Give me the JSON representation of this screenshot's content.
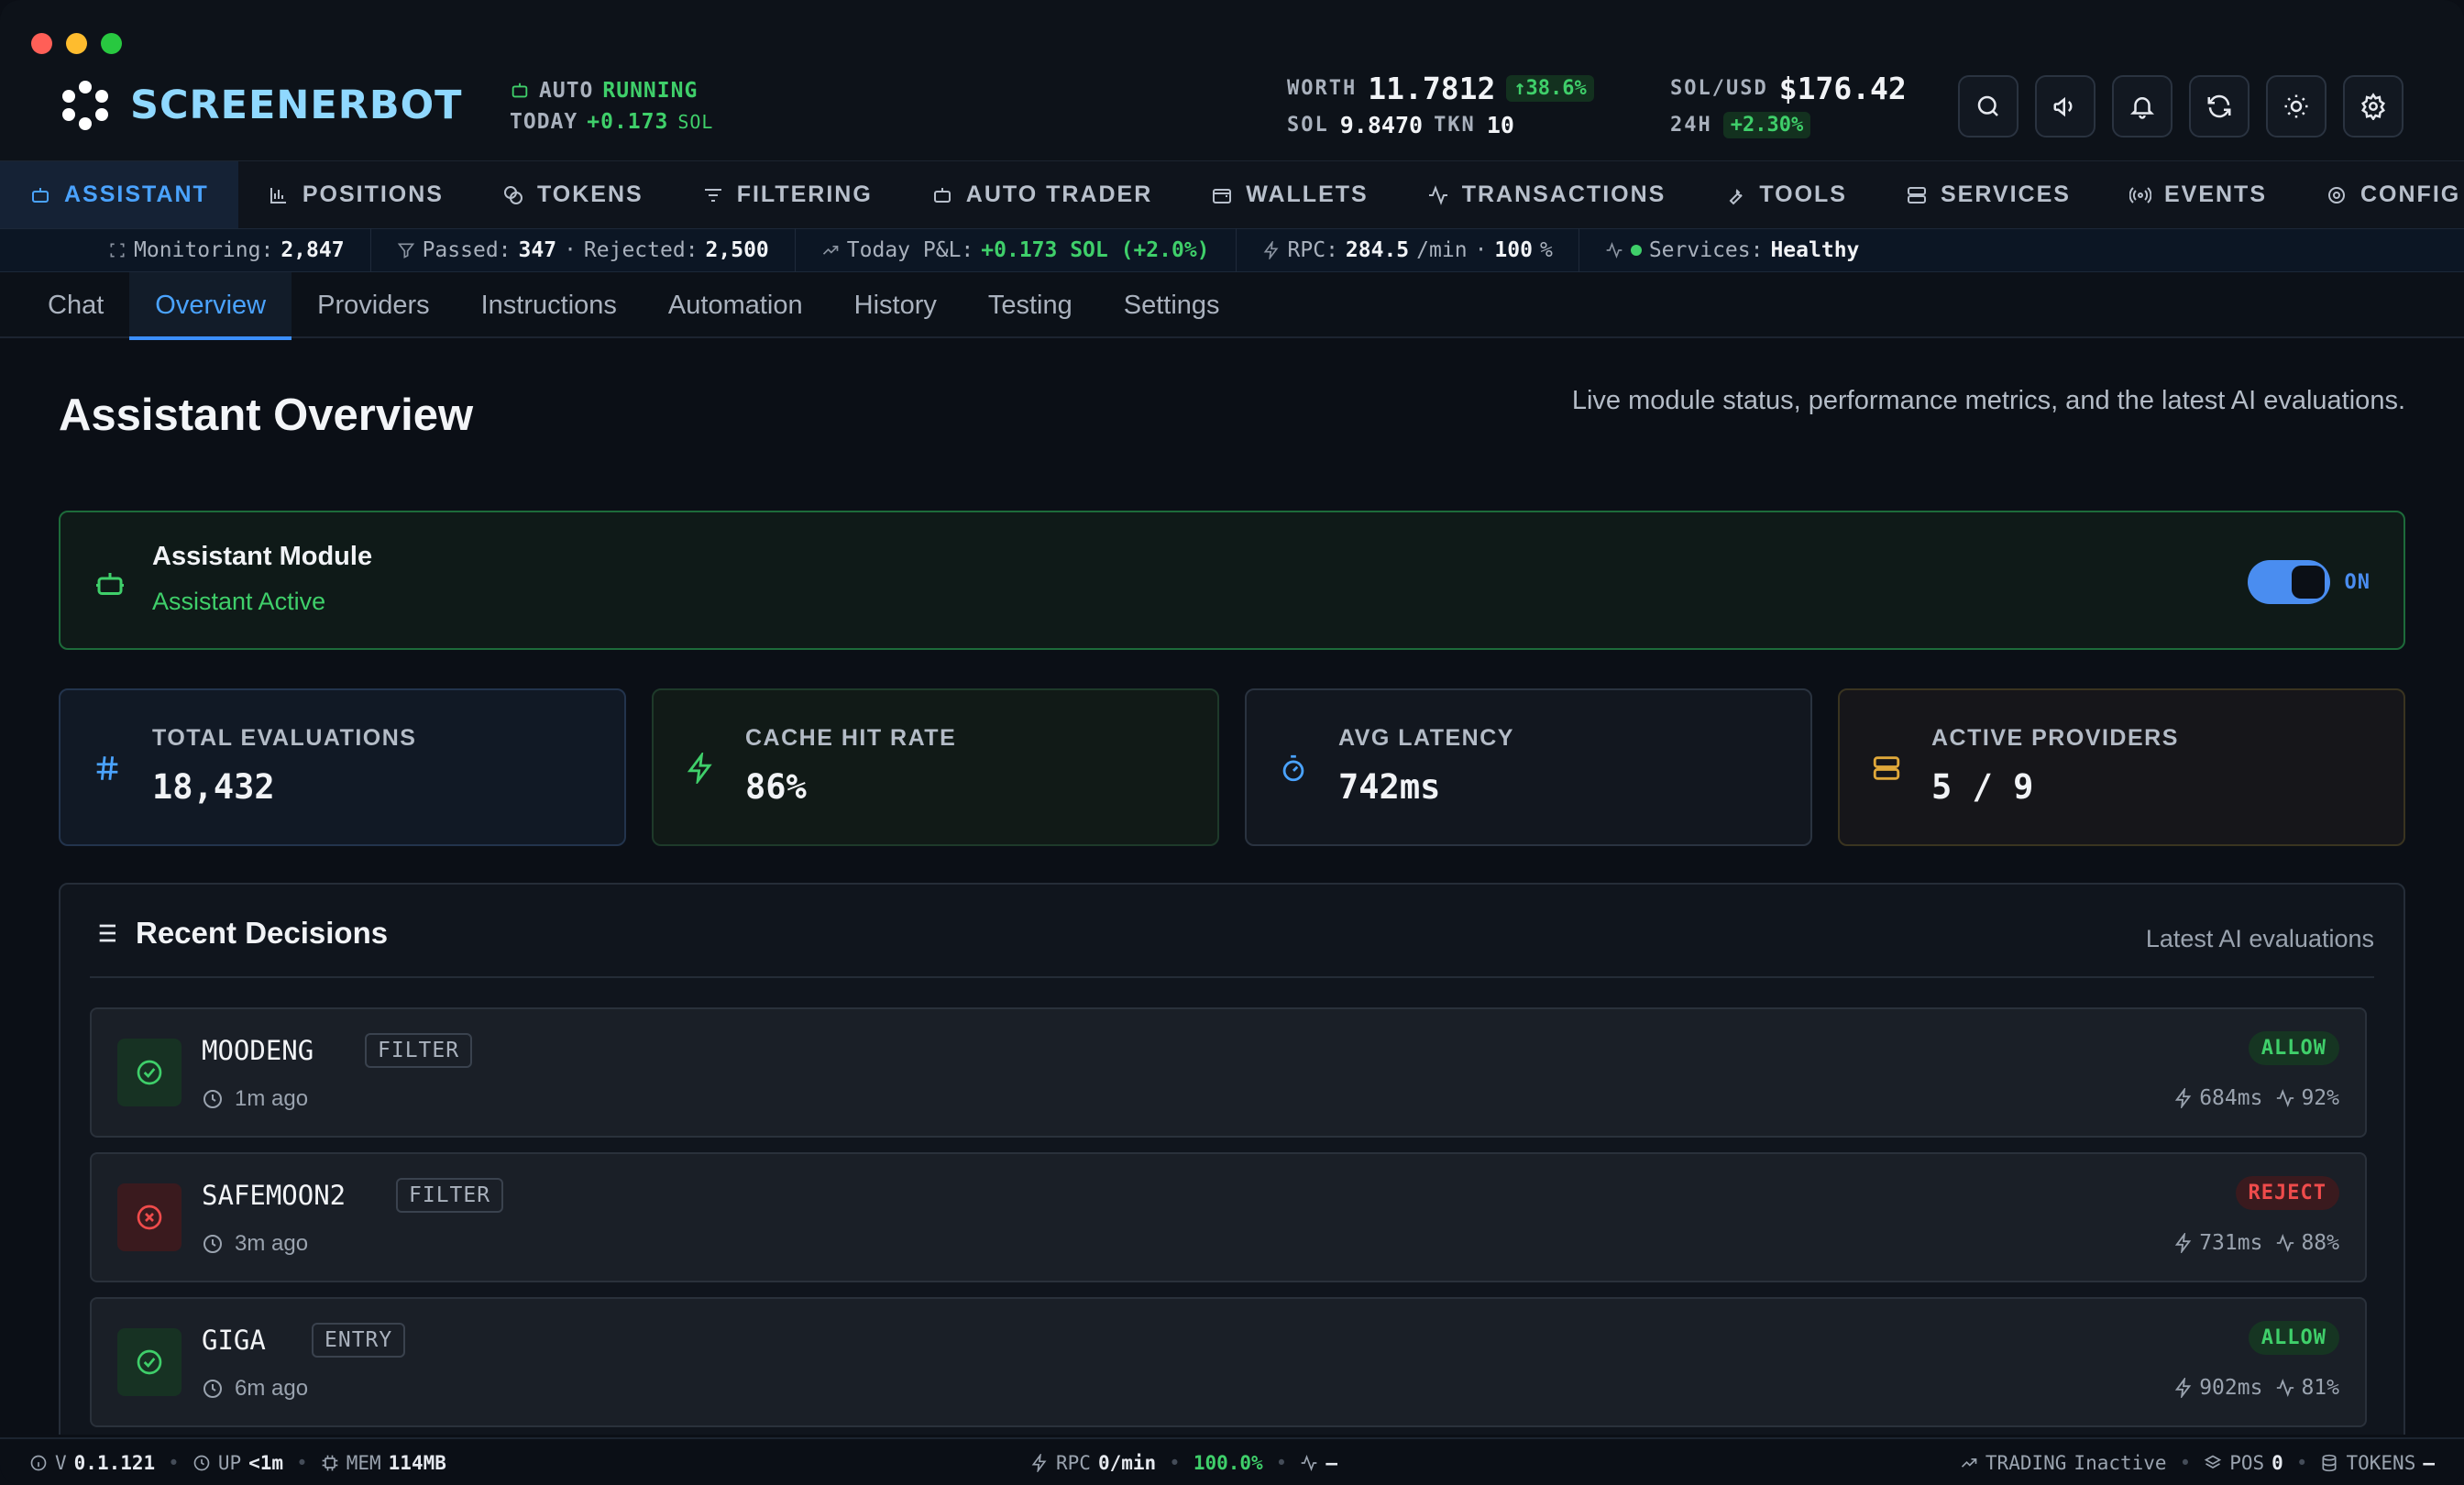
{
  "header": {
    "brand": "SCREENERBOT",
    "auto_label": "AUTO",
    "auto_status": "RUNNING",
    "today_label": "TODAY",
    "today_value": "+0.173",
    "today_unit": "SOL",
    "worth_label": "WORTH",
    "worth_value": "11.7812",
    "worth_change": "↑38.6%",
    "sol_label": "SOL",
    "sol_value": "9.8470",
    "tkn_label": "TKN",
    "tkn_value": "10",
    "solusd_label": "SOL/USD",
    "solusd_value": "$176.42",
    "h24_label": "24H",
    "h24_change": "+2.30%"
  },
  "nav": {
    "items": [
      {
        "label": "ASSISTANT",
        "icon": "bot-icon",
        "active": true
      },
      {
        "label": "POSITIONS",
        "icon": "chart-icon"
      },
      {
        "label": "TOKENS",
        "icon": "coins-icon"
      },
      {
        "label": "FILTERING",
        "icon": "filter-icon"
      },
      {
        "label": "AUTO TRADER",
        "icon": "robot-icon"
      },
      {
        "label": "WALLETS",
        "icon": "wallet-icon"
      },
      {
        "label": "TRANSACTIONS",
        "icon": "activity-icon"
      },
      {
        "label": "TOOLS",
        "icon": "wrench-icon"
      },
      {
        "label": "SERVICES",
        "icon": "server-icon"
      },
      {
        "label": "EVENTS",
        "icon": "radio-icon"
      },
      {
        "label": "CONFIG",
        "icon": "gear-icon"
      }
    ]
  },
  "status": {
    "monitoring_label": "Monitoring:",
    "monitoring_value": "2,847",
    "passed_label": "Passed:",
    "passed_value": "347",
    "rejected_label": "Rejected:",
    "rejected_value": "2,500",
    "pnl_label": "Today P&L:",
    "pnl_value": "+0.173 SOL (+2.0%)",
    "rpc_label": "RPC:",
    "rpc_value": "284.5",
    "rpc_unit": "/min",
    "rpc_pct": "100",
    "rpc_pct_unit": "%",
    "services_label": "Services:",
    "services_value": "Healthy"
  },
  "subtabs": [
    "Chat",
    "Overview",
    "Providers",
    "Instructions",
    "Automation",
    "History",
    "Testing",
    "Settings"
  ],
  "page": {
    "title": "Assistant Overview",
    "subtitle": "Live module status, performance metrics, and the latest AI evaluations."
  },
  "module": {
    "title": "Assistant Module",
    "status": "Assistant Active",
    "toggle_label": "ON"
  },
  "cards": [
    {
      "label": "TOTAL EVALUATIONS",
      "value": "18,432",
      "icon": "hash-icon",
      "color": "#4aa3ff"
    },
    {
      "label": "CACHE HIT RATE",
      "value": "86%",
      "icon": "zap-icon",
      "color": "#3fcf6a"
    },
    {
      "label": "AVG LATENCY",
      "value": "742ms",
      "icon": "timer-icon",
      "color": "#4aa3ff"
    },
    {
      "label": "ACTIVE PROVIDERS",
      "value": "5 / 9",
      "icon": "server-icon",
      "color": "#e0a83a"
    }
  ],
  "decisions": {
    "title": "Recent Decisions",
    "subtitle": "Latest AI evaluations",
    "rows": [
      {
        "name": "MOODENG",
        "type": "FILTER",
        "time": "1m ago",
        "verdict": "ALLOW",
        "latency": "684ms",
        "confidence": "92%"
      },
      {
        "name": "SAFEMOON2",
        "type": "FILTER",
        "time": "3m ago",
        "verdict": "REJECT",
        "latency": "731ms",
        "confidence": "88%"
      },
      {
        "name": "GIGA",
        "type": "ENTRY",
        "time": "6m ago",
        "verdict": "ALLOW",
        "latency": "902ms",
        "confidence": "81%"
      }
    ]
  },
  "footer": {
    "version_label": "V",
    "version": "0.1.121",
    "up_label": "UP",
    "up_value": "<1m",
    "mem_label": "MEM",
    "mem_value": "114MB",
    "rpc_label": "RPC",
    "rpc_value": "0/min",
    "rpc_pct": "100.0%",
    "activity_value": "—",
    "trading_label": "TRADING",
    "trading_value": "Inactive",
    "pos_label": "POS",
    "pos_value": "0",
    "tokens_label": "TOKENS",
    "tokens_value": "—"
  }
}
